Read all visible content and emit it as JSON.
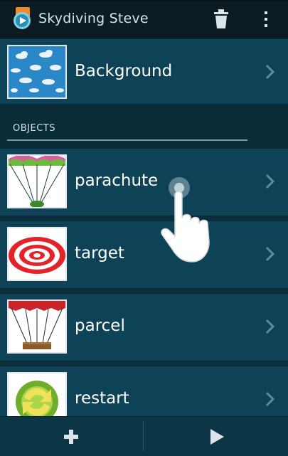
{
  "app": {
    "title": "Skydiving Steve"
  },
  "background_row": {
    "label": "Background"
  },
  "section": {
    "title": "OBJECTS"
  },
  "objects": [
    {
      "label": "parachute"
    },
    {
      "label": "target"
    },
    {
      "label": "parcel"
    },
    {
      "label": "restart"
    }
  ],
  "icons": {
    "app": "app-icon",
    "trash": "trash-icon",
    "overflow": "overflow-menu-icon",
    "chevron": "chevron-right-icon",
    "add": "plus-icon",
    "play": "play-icon",
    "touch": "touch-hand-icon"
  },
  "colors": {
    "action_bar": "#0d1c22",
    "row": "#0e4257",
    "section": "#0a2c39",
    "bottom_bar": "#0c3646"
  }
}
